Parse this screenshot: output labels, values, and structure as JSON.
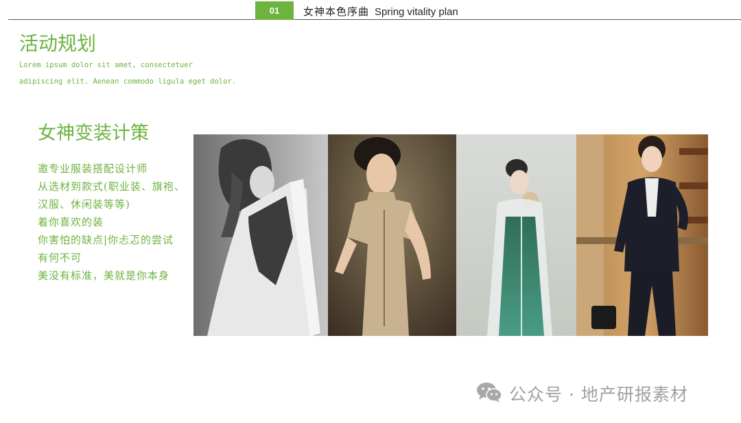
{
  "header": {
    "badge": "01",
    "title_cn": "女神本色序曲",
    "title_en": "Spring vitality plan"
  },
  "main_title": "活动规划",
  "lorem": {
    "line1": "Lorem ipsum dolor sit amet, consectetuer",
    "line2": "adipiscing elit. Aenean commodo ligula eget dolor."
  },
  "section": {
    "title": "女神变装计策",
    "lines": [
      "邀专业服装搭配设计师",
      "从选材到款式(职业装、旗袍、",
      "汉服、休闲装等等)",
      "着你喜欢的装",
      "你害怕的缺点|你忐忑的尝试",
      "有何不可",
      "美没有标准，美就是你本身"
    ]
  },
  "watermark": {
    "text": "公众号 · 地产研报素材",
    "icon": "wechat-icon"
  },
  "colors": {
    "accent": "#6db33f",
    "text_dark": "#222222",
    "watermark": "#a0a0a0"
  }
}
